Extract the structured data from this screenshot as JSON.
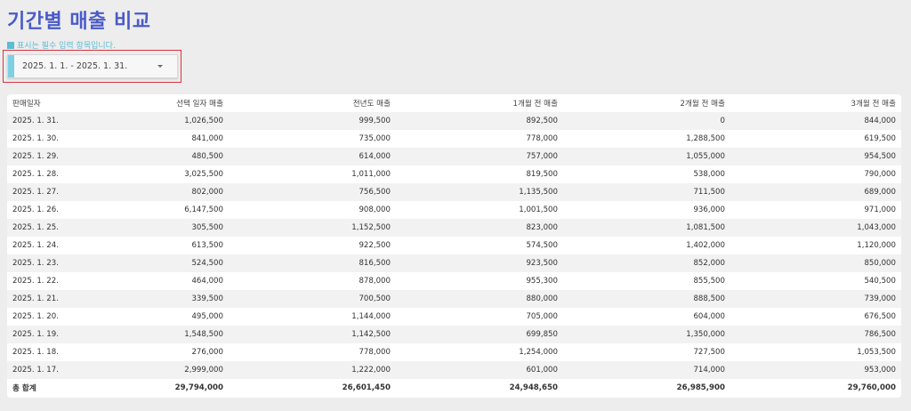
{
  "page": {
    "title": "기간별 매출 비교",
    "required_note": "표시는 필수 입력 항목입니다."
  },
  "date_range": {
    "value": "2025. 1. 1. - 2025. 1. 31."
  },
  "colors": {
    "title": "#4a5bc7",
    "note": "#5bbcd3",
    "accent": "#7fcfe3",
    "highlight_border": "#d9333f"
  },
  "table": {
    "headers": [
      "판매일자",
      "선택 일자 매출",
      "전년도 매출",
      "1개월 전 매출",
      "2개월 전 매출",
      "3개월 전 매출"
    ],
    "rows": [
      [
        "2025. 1. 31.",
        "1,026,500",
        "999,500",
        "892,500",
        "0",
        "844,000"
      ],
      [
        "2025. 1. 30.",
        "841,000",
        "735,000",
        "778,000",
        "1,288,500",
        "619,500"
      ],
      [
        "2025. 1. 29.",
        "480,500",
        "614,000",
        "757,000",
        "1,055,000",
        "954,500"
      ],
      [
        "2025. 1. 28.",
        "3,025,500",
        "1,011,000",
        "819,500",
        "538,000",
        "790,000"
      ],
      [
        "2025. 1. 27.",
        "802,000",
        "756,500",
        "1,135,500",
        "711,500",
        "689,000"
      ],
      [
        "2025. 1. 26.",
        "6,147,500",
        "908,000",
        "1,001,500",
        "936,000",
        "971,000"
      ],
      [
        "2025. 1. 25.",
        "305,500",
        "1,152,500",
        "823,000",
        "1,081,500",
        "1,043,000"
      ],
      [
        "2025. 1. 24.",
        "613,500",
        "922,500",
        "574,500",
        "1,402,000",
        "1,120,000"
      ],
      [
        "2025. 1. 23.",
        "524,500",
        "816,500",
        "923,500",
        "852,000",
        "850,000"
      ],
      [
        "2025. 1. 22.",
        "464,000",
        "878,000",
        "955,300",
        "855,500",
        "540,500"
      ],
      [
        "2025. 1. 21.",
        "339,500",
        "700,500",
        "880,000",
        "888,500",
        "739,000"
      ],
      [
        "2025. 1. 20.",
        "495,000",
        "1,144,000",
        "705,000",
        "604,000",
        "676,500"
      ],
      [
        "2025. 1. 19.",
        "1,548,500",
        "1,142,500",
        "699,850",
        "1,350,000",
        "786,500"
      ],
      [
        "2025. 1. 18.",
        "276,000",
        "778,000",
        "1,254,000",
        "727,500",
        "1,053,500"
      ],
      [
        "2025. 1. 17.",
        "2,999,000",
        "1,222,000",
        "601,000",
        "714,000",
        "953,000"
      ]
    ],
    "total": [
      "총 합계",
      "29,794,000",
      "26,601,450",
      "24,948,650",
      "26,985,900",
      "29,760,000"
    ]
  }
}
